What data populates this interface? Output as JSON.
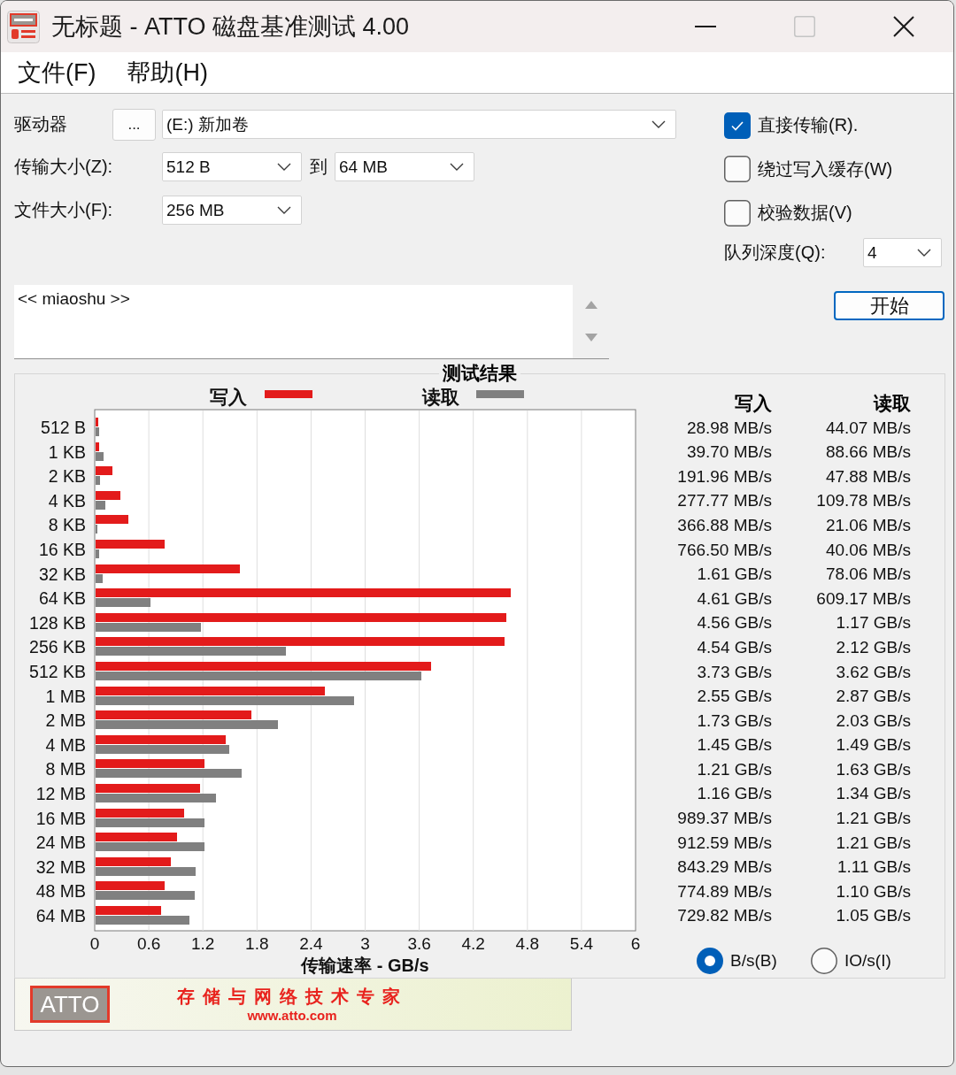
{
  "window": {
    "title": "无标题 - ATTO 磁盘基准测试 4.00",
    "controls": [
      {
        "kind": "minimize",
        "disabled": false
      },
      {
        "kind": "maximize",
        "disabled": true
      },
      {
        "kind": "close",
        "disabled": false
      }
    ]
  },
  "menu": [
    "文件(F)",
    "帮助(H)"
  ],
  "settings": {
    "drive": {
      "label": "驱动器",
      "browse_button": "...",
      "value": "(E:) 新加卷"
    },
    "transfer_size": {
      "label": "传输大小(Z):",
      "from": "512 B",
      "to_label": "到",
      "to": "64 MB"
    },
    "file_size": {
      "label": "文件大小(F):",
      "value": "256 MB"
    },
    "options": [
      {
        "label": "直接传输(R).",
        "checked": true
      },
      {
        "label": "绕过写入缓存(W)",
        "checked": false
      },
      {
        "label": "校验数据(V)",
        "checked": false
      }
    ],
    "queue_depth": {
      "label": "队列深度(Q):",
      "value": "4"
    }
  },
  "description": {
    "value": "<< miaoshu >>"
  },
  "start_button": "开始",
  "results": {
    "chart_data": {
      "type": "bar",
      "orientation": "horizontal",
      "title": "测试结果",
      "xlabel": "传输速率 - GB/s",
      "categories": [
        "512 B",
        "1 KB",
        "2 KB",
        "4 KB",
        "8 KB",
        "16 KB",
        "32 KB",
        "64 KB",
        "128 KB",
        "256 KB",
        "512 KB",
        "1 MB",
        "2 MB",
        "4 MB",
        "8 MB",
        "12 MB",
        "16 MB",
        "24 MB",
        "32 MB",
        "48 MB",
        "64 MB"
      ],
      "series": [
        {
          "name": "写入",
          "color": "#e31b1b",
          "values": [
            0.03,
            0.04,
            0.19,
            0.28,
            0.37,
            0.77,
            1.61,
            4.61,
            4.56,
            4.54,
            3.73,
            2.55,
            1.73,
            1.45,
            1.21,
            1.16,
            0.99,
            0.91,
            0.84,
            0.77,
            0.73
          ]
        },
        {
          "name": "读取",
          "color": "#808080",
          "values": [
            0.04,
            0.09,
            0.05,
            0.11,
            0.02,
            0.04,
            0.08,
            0.61,
            1.17,
            2.12,
            3.62,
            2.87,
            2.03,
            1.49,
            1.63,
            1.34,
            1.21,
            1.21,
            1.11,
            1.1,
            1.05
          ]
        }
      ],
      "xlim": [
        0,
        6
      ],
      "xticks": [
        0,
        0.6,
        1.2,
        1.8,
        2.4,
        3,
        3.6,
        4.2,
        4.8,
        5.4,
        6
      ],
      "grid": true,
      "legend": "top"
    },
    "table": {
      "columns": [
        "写入",
        "读取"
      ],
      "rows": [
        {
          "write": "28.98 MB/s",
          "read": "44.07 MB/s"
        },
        {
          "write": "39.70 MB/s",
          "read": "88.66 MB/s"
        },
        {
          "write": "191.96 MB/s",
          "read": "47.88 MB/s"
        },
        {
          "write": "277.77 MB/s",
          "read": "109.78 MB/s"
        },
        {
          "write": "366.88 MB/s",
          "read": "21.06 MB/s"
        },
        {
          "write": "766.50 MB/s",
          "read": "40.06 MB/s"
        },
        {
          "write": "1.61 GB/s",
          "read": "78.06 MB/s"
        },
        {
          "write": "4.61 GB/s",
          "read": "609.17 MB/s"
        },
        {
          "write": "4.56 GB/s",
          "read": "1.17 GB/s"
        },
        {
          "write": "4.54 GB/s",
          "read": "2.12 GB/s"
        },
        {
          "write": "3.73 GB/s",
          "read": "3.62 GB/s"
        },
        {
          "write": "2.55 GB/s",
          "read": "2.87 GB/s"
        },
        {
          "write": "1.73 GB/s",
          "read": "2.03 GB/s"
        },
        {
          "write": "1.45 GB/s",
          "read": "1.49 GB/s"
        },
        {
          "write": "1.21 GB/s",
          "read": "1.63 GB/s"
        },
        {
          "write": "1.16 GB/s",
          "read": "1.34 GB/s"
        },
        {
          "write": "989.37 MB/s",
          "read": "1.21 GB/s"
        },
        {
          "write": "912.59 MB/s",
          "read": "1.21 GB/s"
        },
        {
          "write": "843.29 MB/s",
          "read": "1.11 GB/s"
        },
        {
          "write": "774.89 MB/s",
          "read": "1.10 GB/s"
        },
        {
          "write": "729.82 MB/s",
          "read": "1.05 GB/s"
        }
      ]
    },
    "units": [
      {
        "label": "B/s(B)",
        "selected": true
      },
      {
        "label": "IO/s(I)",
        "selected": false
      }
    ]
  },
  "banner": {
    "logo": "ATTO",
    "slogan": "存储与网络技术专家",
    "url": "www.atto.com"
  }
}
